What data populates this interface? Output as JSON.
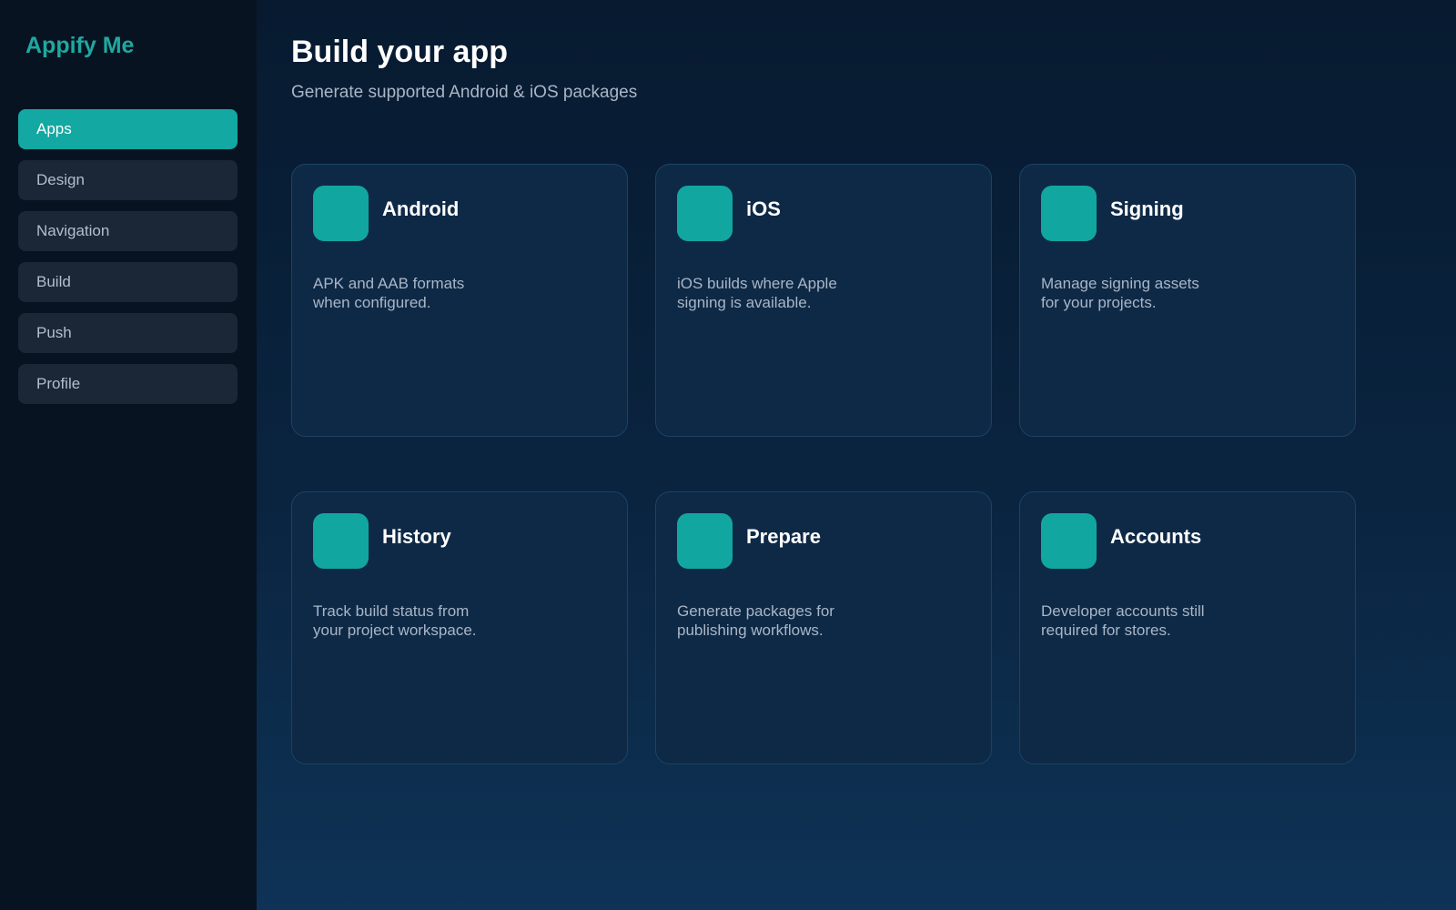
{
  "sidebar": {
    "brand": "Appify Me",
    "items": [
      {
        "label": "Apps",
        "active": true
      },
      {
        "label": "Design",
        "active": false
      },
      {
        "label": "Navigation",
        "active": false
      },
      {
        "label": "Build",
        "active": false
      },
      {
        "label": "Push",
        "active": false
      },
      {
        "label": "Profile",
        "active": false
      }
    ]
  },
  "main": {
    "title": "Build your app",
    "subtitle": "Generate supported Android & iOS packages",
    "cards": [
      {
        "title": "Android",
        "desc_line1": "APK and AAB formats",
        "desc_line2": "when configured."
      },
      {
        "title": "iOS",
        "desc_line1": "iOS builds where Apple",
        "desc_line2": "signing is available."
      },
      {
        "title": "Signing",
        "desc_line1": "Manage signing assets",
        "desc_line2": "for your projects."
      },
      {
        "title": "History",
        "desc_line1": "Track build status from",
        "desc_line2": "your project workspace."
      },
      {
        "title": "Prepare",
        "desc_line1": "Generate packages for",
        "desc_line2": "publishing workflows."
      },
      {
        "title": "Accounts",
        "desc_line1": "Developer accounts still",
        "desc_line2": "required for stores."
      }
    ]
  },
  "colors": {
    "accent": "#13a8a1",
    "sidebar_bg": "#081321",
    "card_bg": "#0e2946"
  }
}
